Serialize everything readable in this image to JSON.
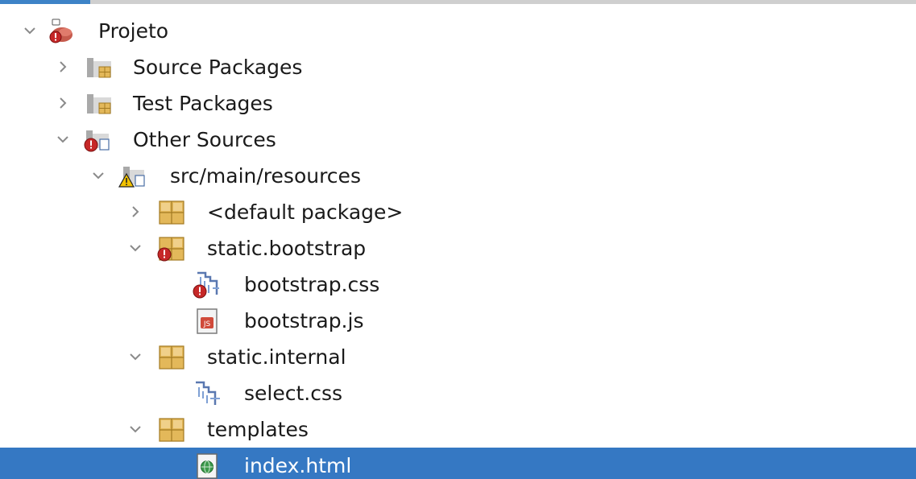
{
  "tree": {
    "root": {
      "label": "Projeto",
      "expanded": true,
      "icon": "maven-project-error-icon"
    },
    "source_packages": {
      "label": "Source Packages",
      "expanded": false,
      "icon": "source-packages-folder-icon"
    },
    "test_packages": {
      "label": "Test Packages",
      "expanded": false,
      "icon": "test-packages-folder-icon"
    },
    "other_sources": {
      "label": "Other Sources",
      "expanded": true,
      "icon": "other-sources-error-icon"
    },
    "resources": {
      "label": "src/main/resources",
      "expanded": true,
      "icon": "resources-folder-warning-icon"
    },
    "default_package": {
      "label": "<default package>",
      "expanded": false,
      "icon": "package-icon"
    },
    "static_bootstrap": {
      "label": "static.bootstrap",
      "expanded": true,
      "icon": "package-error-icon"
    },
    "bootstrap_css": {
      "label": "bootstrap.css",
      "icon": "css-file-error-icon"
    },
    "bootstrap_js": {
      "label": "bootstrap.js",
      "icon": "js-file-icon"
    },
    "static_internal": {
      "label": "static.internal",
      "expanded": true,
      "icon": "package-icon"
    },
    "select_css": {
      "label": "select.css",
      "icon": "css-file-icon"
    },
    "templates": {
      "label": "templates",
      "expanded": true,
      "icon": "package-icon"
    },
    "index_html": {
      "label": "index.html",
      "selected": true,
      "icon": "html-file-icon"
    }
  },
  "colors": {
    "selection": "#3578c3",
    "tab_accent": "#3d83c7",
    "package": "#e3b85a",
    "error": "#d32f2f",
    "warning": "#f2c200"
  }
}
